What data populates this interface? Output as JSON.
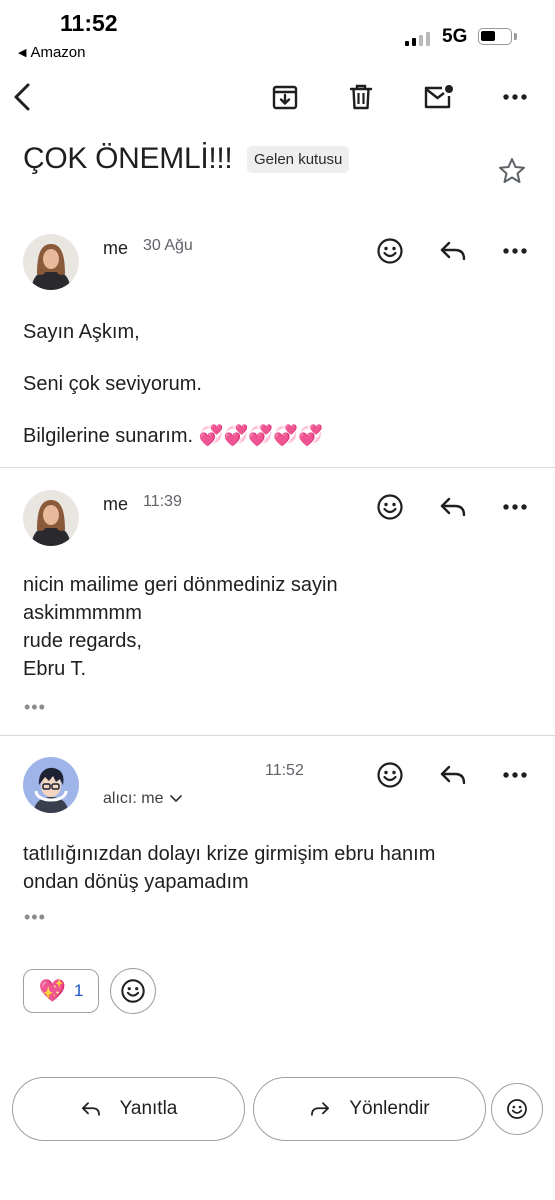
{
  "status_bar": {
    "time": "11:52",
    "back_app": "Amazon",
    "network": "5G"
  },
  "toolbar": {
    "icons": [
      "back-arrow-icon",
      "archive-icon",
      "trash-icon",
      "mark-unread-icon",
      "more-vert-icon"
    ]
  },
  "thread": {
    "subject": "ÇOK ÖNEMLİ!!!",
    "label": "Gelen kutusu"
  },
  "messages": [
    {
      "sender": "me",
      "date": "30 Ağu",
      "body": [
        "Sayın Aşkım,",
        "",
        "Seni çok seviyorum.",
        "",
        "Bilgilerine sunarım. 💞💞💞💞💞"
      ]
    },
    {
      "sender": "me",
      "date": "11:39",
      "body": [
        "nicin mailime geri dönmediniz sayin",
        "askimmmmm",
        "rude regards,",
        "Ebru T."
      ],
      "trimmed": "•••"
    },
    {
      "sender": "",
      "date": "11:52",
      "recipient": "alıcı: me",
      "body": [
        "tatlılığınızdan dolayı krize girmişim ebru hanım",
        "ondan dönüş yapamadım"
      ],
      "trimmed": "•••",
      "reaction": {
        "emoji": "💖",
        "count": "1"
      }
    }
  ],
  "footer": {
    "reply": "Yanıtla",
    "forward": "Yönlendir"
  },
  "colors": {
    "link_blue": "#1a56c5",
    "text": "#1f1f1f",
    "muted": "#5f6368",
    "divider": "#d9d9d9"
  }
}
